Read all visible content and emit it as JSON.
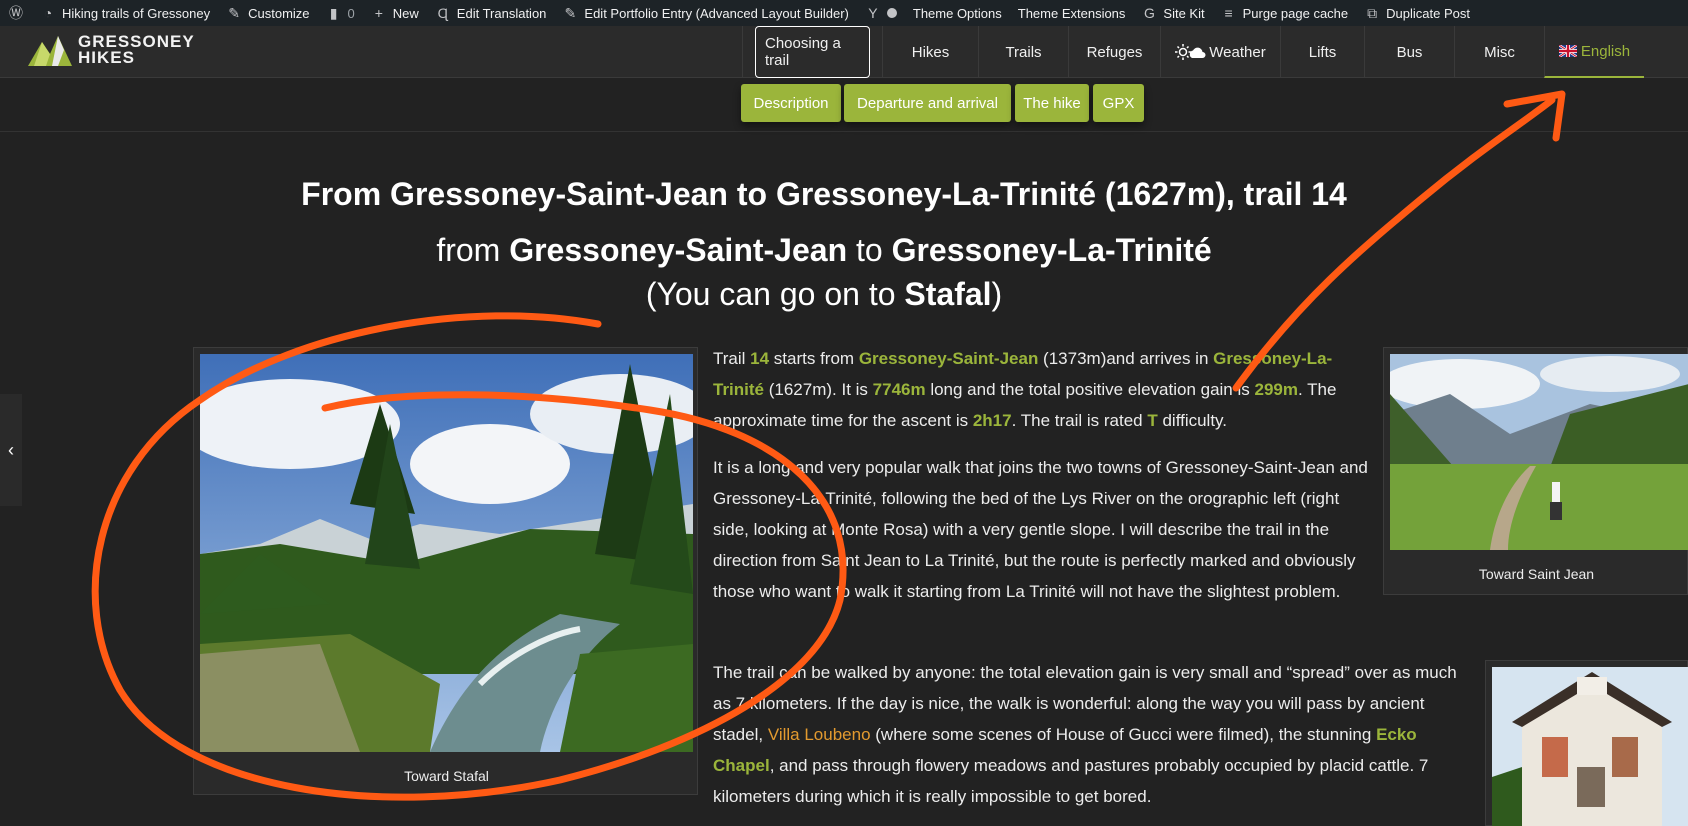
{
  "adminbar": {
    "site": "Hiking trails of Gressoney",
    "customize": "Customize",
    "comments": "0",
    "new": "New",
    "edit_translation": "Edit Translation",
    "edit_portfolio": "Edit Portfolio Entry (Advanced Layout Builder)",
    "theme_options": "Theme Options",
    "theme_extensions": "Theme Extensions",
    "site_kit": "Site Kit",
    "purge": "Purge page cache",
    "duplicate": "Duplicate Post"
  },
  "logo": {
    "line1": "GRESSONEY",
    "line2": "HIKES"
  },
  "nav": [
    {
      "label": "Choosing a trail"
    },
    {
      "label": "Hikes"
    },
    {
      "label": "Trails"
    },
    {
      "label": "Refuges"
    },
    {
      "label": "Weather"
    },
    {
      "label": "Lifts"
    },
    {
      "label": "Bus"
    },
    {
      "label": "Misc"
    },
    {
      "label": "English"
    }
  ],
  "subnav": [
    "Description",
    "Departure and arrival",
    "The hike",
    "GPX"
  ],
  "titles": {
    "main": "From Gressoney-Saint-Jean to Gressoney-La-Trinité (1627m), trail 14",
    "from_word": "from",
    "from_place": "Gressoney-Saint-Jean",
    "to_word": "to",
    "to_place": "Gressoney-La-Trinité",
    "goon_open": "(You can go on to",
    "goon_place": "Stafal",
    "goon_close": ")"
  },
  "figures": {
    "left_caption": "Toward Stafal",
    "right_caption": "Toward Saint Jean"
  },
  "para1": {
    "s1": "Trail ",
    "trail": "14",
    "s2": " starts from ",
    "from": "Gressoney-Saint-Jean",
    "s3": " (1373m)and arrives in ",
    "to": "Gressoney-La-Trinité",
    "s4": " (1627m). It is ",
    "length": "7746m",
    "s5": " long and the total positive elevation gain is ",
    "gain": "299m",
    "s6": ". The approximate time for the ascent is ",
    "time": "2h17",
    "s7": ". The trail is rated ",
    "rating": "T",
    "s8": " difficulty."
  },
  "para2": "It is a long and very popular walk that joins the two towns of Gressoney-Saint-Jean and Gressoney-La-Trinité, following the bed of the Lys River on the orographic left (right side, looking at Monte Rosa) with a very gentle slope. I will describe the trail in the direction from Saint Jean to La Trinité, but the route is perfectly marked and obviously those who want to walk it starting from La Trinité will not have the slightest problem.",
  "para3": {
    "s1": "The trail can be walked by anyone: the total elevation gain is very small and “spread” over as much as 7 kilometers. If the day is nice, the walk is wonderful: along the way you will pass by ancient stadel, ",
    "villa": "Villa Loubeno",
    "s2": " (where some scenes of House of Gucci were filmed), the stunning ",
    "chapel": "Ecko Chapel",
    "s3": ", and pass through flowery meadows and pastures probably occupied by placid cattle. 7 kilometers during which it is really impossible to get bored."
  },
  "colors": {
    "accent": "#9bb53b",
    "link": "#e39a2f",
    "annotation": "#ff5a14",
    "background": "#222222"
  }
}
